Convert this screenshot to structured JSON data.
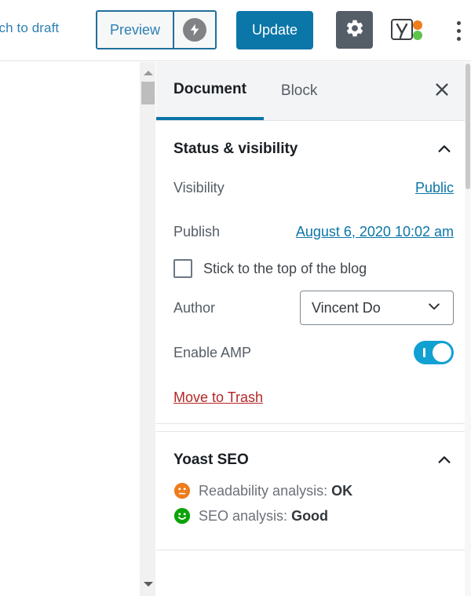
{
  "header": {
    "switch_to_draft": "Switch to draft",
    "preview_label": "Preview",
    "amp_preview_icon": "lightning-bolt-icon",
    "update_label": "Update",
    "settings_icon": "gear-icon",
    "yoast_icon": "yoast-seo-icon",
    "more_menu_icon": "kebab-menu-icon"
  },
  "sidebar": {
    "tabs": [
      {
        "label": "Document",
        "active": true
      },
      {
        "label": "Block",
        "active": false
      }
    ],
    "close_icon": "close-icon",
    "panels": [
      {
        "title": "Status & visibility",
        "collapse_icon": "chevron-up-icon",
        "rows": {
          "visibility_label": "Visibility",
          "visibility_value": "Public",
          "publish_label": "Publish",
          "publish_value": "August 6, 2020 10:02 am",
          "sticky_label": "Stick to the top of the blog",
          "sticky_checked": false,
          "author_label": "Author",
          "author_value": "Vincent Do",
          "amp_label": "Enable AMP",
          "amp_enabled": true,
          "trash_label": "Move to Trash"
        }
      },
      {
        "title": "Yoast SEO",
        "collapse_icon": "chevron-up-icon",
        "analyses": [
          {
            "icon": "neutral-face-icon",
            "color": "#ee7c1b",
            "label": "Readability analysis:",
            "value": "OK"
          },
          {
            "icon": "smiley-face-icon",
            "color": "#0ca30a",
            "label": "SEO analysis:",
            "value": "Good"
          }
        ]
      }
    ]
  },
  "colors": {
    "accent_blue": "#0b76a8",
    "toggle_on": "#11a0d2",
    "danger_red": "#b52727",
    "gear_active_bg": "#555d66",
    "yoast_orange": "#ee7c1b",
    "yoast_green": "#0ca30a"
  },
  "scrollbars": {
    "editor_up_arrow": "scroll-up-arrow-icon",
    "editor_down_arrow": "scroll-down-arrow-icon"
  }
}
